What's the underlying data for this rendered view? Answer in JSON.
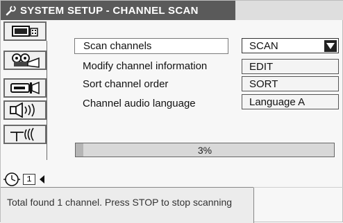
{
  "header": {
    "title": "SYSTEM SETUP - CHANNEL SCAN",
    "icon": "wrench-icon"
  },
  "sidebar": {
    "items": [
      {
        "name": "tv-icon",
        "selected": false
      },
      {
        "name": "projector-icon",
        "selected": false
      },
      {
        "name": "video-camera-icon",
        "selected": false
      },
      {
        "name": "speaker-icon",
        "selected": false
      },
      {
        "name": "antenna-icon",
        "selected": false
      }
    ],
    "current": {
      "icon": "clock-icon",
      "page": "1"
    }
  },
  "menu": {
    "items": [
      {
        "label": "Scan channels",
        "option": "SCAN"
      },
      {
        "label": "Modify channel information",
        "option": "EDIT"
      },
      {
        "label": "Sort channel order",
        "option": "SORT"
      },
      {
        "label": "Channel audio language",
        "option": "Language A"
      }
    ]
  },
  "progress": {
    "label": "3%",
    "value": 0.03
  },
  "status": {
    "message": "Total found 1 channel. Press STOP to stop scanning"
  }
}
